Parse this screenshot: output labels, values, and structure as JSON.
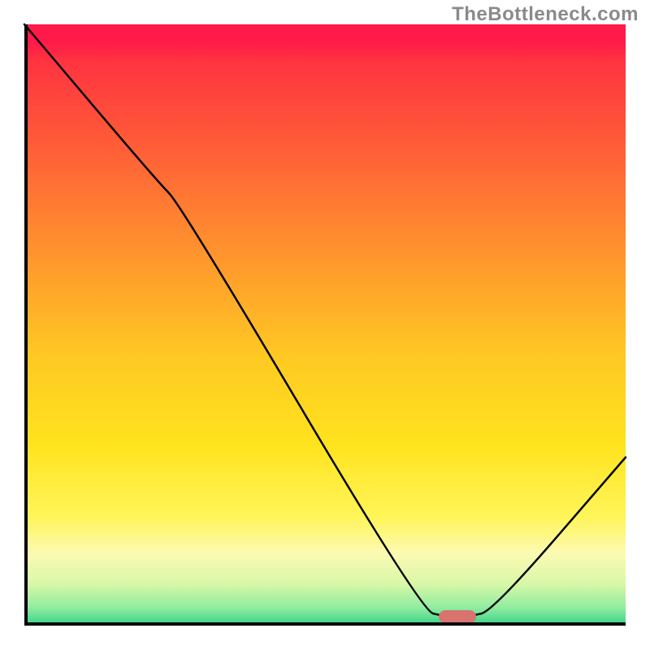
{
  "watermark": "TheBottleneck.com",
  "chart_data": {
    "type": "line",
    "title": "",
    "xlabel": "",
    "ylabel": "",
    "xlim": [
      0,
      100
    ],
    "ylim": [
      0,
      100
    ],
    "x": [
      0,
      22,
      26,
      66,
      70,
      74,
      78,
      100
    ],
    "values": [
      100,
      74,
      70,
      2.5,
      1.5,
      1.5,
      2.5,
      28
    ],
    "marker": {
      "x": 72,
      "y": 1.5,
      "shape": "pill",
      "color": "#d8736f"
    },
    "background_gradient": {
      "direction": "vertical",
      "stops": [
        {
          "pos": 0.0,
          "color": "#ff1a4a"
        },
        {
          "pos": 0.2,
          "color": "#ff5c38"
        },
        {
          "pos": 0.4,
          "color": "#ff9a2c"
        },
        {
          "pos": 0.55,
          "color": "#ffc823"
        },
        {
          "pos": 0.7,
          "color": "#ffe31e"
        },
        {
          "pos": 0.88,
          "color": "#fcfab2"
        },
        {
          "pos": 0.97,
          "color": "#90eda0"
        },
        {
          "pos": 1.0,
          "color": "#35d28a"
        }
      ]
    },
    "grid": false,
    "legend": false
  }
}
